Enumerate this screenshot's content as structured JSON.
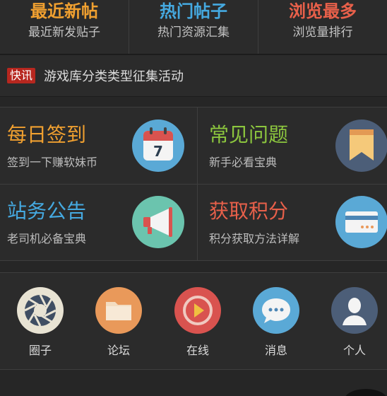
{
  "top_tabs": [
    {
      "title": "最近新帖",
      "subtitle": "最近新发贴子",
      "color": "#f0a030"
    },
    {
      "title": "热门帖子",
      "subtitle": "热门资源汇集",
      "color": "#45a9e0"
    },
    {
      "title": "浏览最多",
      "subtitle": "浏览量排行",
      "color": "#e8604a"
    }
  ],
  "news": {
    "badge": "快讯",
    "text": "游戏库分类类型征集活动"
  },
  "cards": [
    {
      "title": "每日签到",
      "subtitle": "签到一下赚软妹币",
      "color": "#f0a030",
      "icon": "calendar-icon",
      "calendar_day": "7"
    },
    {
      "title": "常见问题",
      "subtitle": "新手必看宝典",
      "color": "#8cc63e",
      "icon": "bookmark-icon"
    },
    {
      "title": "站务公告",
      "subtitle": "老司机必备宝典",
      "color": "#45a9e0",
      "icon": "megaphone-icon"
    },
    {
      "title": "获取积分",
      "subtitle": "积分获取方法详解",
      "color": "#e8604a",
      "icon": "credit-card-icon"
    }
  ],
  "bottom_icons": [
    {
      "label": "圈子",
      "icon": "aperture-icon",
      "color": "#e8e3d3"
    },
    {
      "label": "论坛",
      "icon": "folder-icon",
      "color": "#e9995a"
    },
    {
      "label": "在线",
      "icon": "play-icon",
      "color": "#d9534f"
    },
    {
      "label": "消息",
      "icon": "chat-bubble-icon",
      "color": "#5aa9d6"
    },
    {
      "label": "个人",
      "icon": "user-icon",
      "color": "#4c5e78"
    }
  ]
}
